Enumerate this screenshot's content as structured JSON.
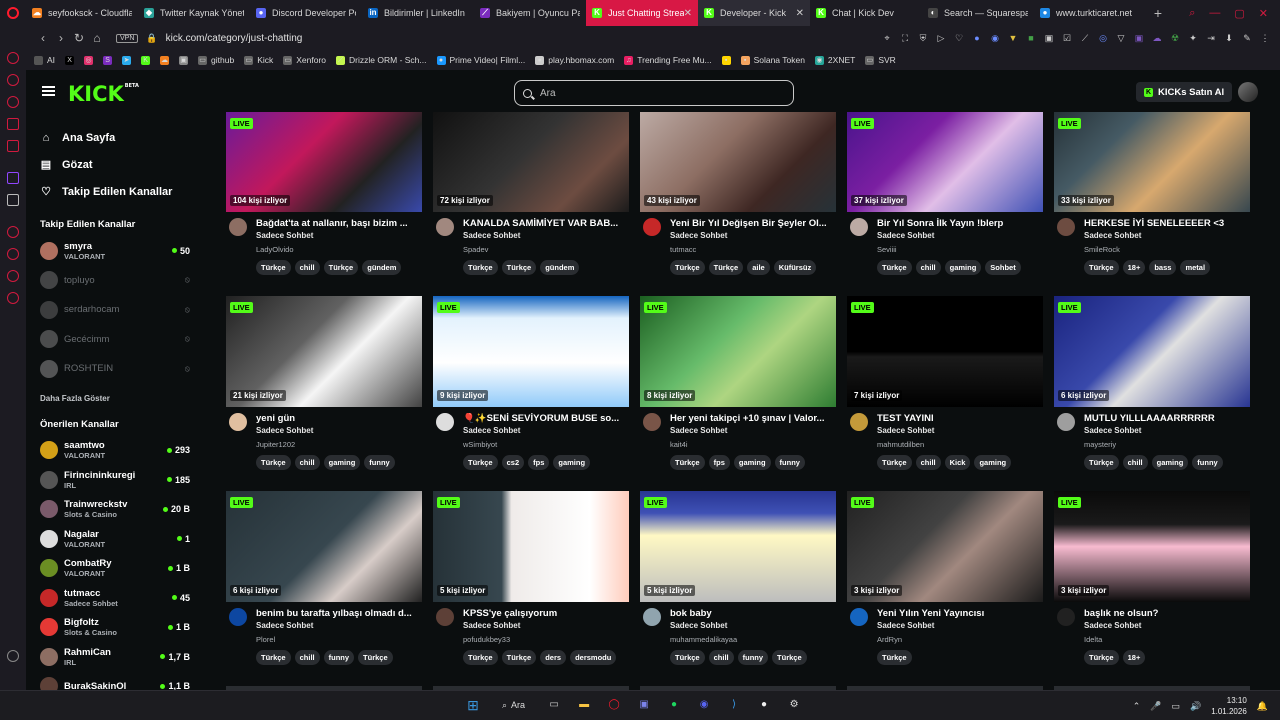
{
  "browser": {
    "tabs": [
      {
        "title": "seyfooksck - Cloudfla",
        "fav_color": "#f38020",
        "fav_glyph": "☁"
      },
      {
        "title": "Twitter Kaynak Yönet",
        "fav_color": "#2aa198",
        "fav_glyph": "◆"
      },
      {
        "title": "Discord Developer Po",
        "fav_color": "#5865f2",
        "fav_glyph": "●"
      },
      {
        "title": "Bildirimler | LinkedIn",
        "fav_color": "#0a66c2",
        "fav_glyph": "in"
      },
      {
        "title": "Bakiyem | Oyuncu Pa",
        "fav_color": "#7b2cbf",
        "fav_glyph": "⟋"
      },
      {
        "title": "Just Chatting Streaming",
        "fav_color": "#53fc18",
        "fav_glyph": "K"
      },
      {
        "title": "Developer - Kick",
        "fav_color": "#53fc18",
        "fav_glyph": "K"
      },
      {
        "title": "Chat | Kick Dev",
        "fav_color": "#53fc18",
        "fav_glyph": "K"
      },
      {
        "title": "Search — Squarespa",
        "fav_color": "#444444",
        "fav_glyph": "◐"
      },
      {
        "title": "www.turkticaret.net",
        "fav_color": "#1e88e5",
        "fav_glyph": "●"
      }
    ],
    "new_tab": "+",
    "url": "kick.com/category/just-chatting",
    "vpn_label": "VPN",
    "bookmarks": [
      {
        "label": "AI",
        "color": "#555555"
      },
      {
        "label": "",
        "color": "#000000",
        "glyph": "X"
      },
      {
        "label": "",
        "color": "#e1306c",
        "glyph": "◎"
      },
      {
        "label": "",
        "color": "#7b2cbf",
        "glyph": "S"
      },
      {
        "label": "",
        "color": "#2aabee",
        "glyph": "➤"
      },
      {
        "label": "",
        "color": "#53fc18",
        "glyph": "K"
      },
      {
        "label": "",
        "color": "#f38020",
        "glyph": "☁"
      },
      {
        "label": "",
        "color": "#888888",
        "glyph": "▣"
      },
      {
        "label": "github",
        "color": "#666666",
        "glyph": "▭"
      },
      {
        "label": "Kick",
        "color": "#666666",
        "glyph": "▭"
      },
      {
        "label": "Xenforo",
        "color": "#666666",
        "glyph": "▭"
      },
      {
        "label": "Drizzle ORM - Sch...",
        "color": "#c5f74f",
        "glyph": "⟋"
      },
      {
        "label": "Prime Video| Filml...",
        "color": "#1a98ff",
        "glyph": "●"
      },
      {
        "label": "play.hbomax.com",
        "color": "#cccccc",
        "glyph": "●"
      },
      {
        "label": "Trending Free Mu...",
        "color": "#e91e63",
        "glyph": "♫"
      },
      {
        "label": "",
        "color": "#ffd600",
        "glyph": "▪"
      },
      {
        "label": "Solana Token",
        "color": "#f4a460",
        "glyph": "▪"
      },
      {
        "label": "2XNET",
        "color": "#26a69a",
        "glyph": "◉"
      },
      {
        "label": "SVR",
        "color": "#666666",
        "glyph": "▭"
      }
    ]
  },
  "kick": {
    "logo": "KICK",
    "logo_badge": "BETA",
    "search_placeholder": "Ara",
    "kicks_button": "KICKs Satın Al",
    "nav": [
      {
        "label": "Ana Sayfa",
        "icon": "home-icon",
        "glyph": "⌂"
      },
      {
        "label": "Gözat",
        "icon": "browse-icon",
        "glyph": "▤"
      },
      {
        "label": "Takip Edilen Kanallar",
        "icon": "heart-icon",
        "glyph": "♡"
      }
    ],
    "followed_title": "Takip Edilen Kanallar",
    "followed": [
      {
        "name": "smyra",
        "category": "VALORANT",
        "count": "50",
        "online": true,
        "color": "#b07060"
      },
      {
        "name": "topluyo",
        "category": "",
        "count": "",
        "online": false,
        "color": "#888888"
      },
      {
        "name": "serdarhocam",
        "category": "",
        "count": "",
        "online": false,
        "color": "#777777"
      },
      {
        "name": "Gecécimm",
        "category": "",
        "count": "",
        "online": false,
        "color": "#999999"
      },
      {
        "name": "ROSHTEIN",
        "category": "",
        "count": "",
        "online": false,
        "color": "#aaaaaa"
      }
    ],
    "show_more": "Daha Fazla Göster",
    "suggested_title": "Önerilen Kanallar",
    "suggested": [
      {
        "name": "saamtwo",
        "category": "VALORANT",
        "count": "293",
        "color": "#d4a017"
      },
      {
        "name": "Firincininkuregi",
        "category": "IRL",
        "count": "185",
        "color": "#555555"
      },
      {
        "name": "Trainwreckstv",
        "category": "Slots & Casino",
        "count": "20 B",
        "color": "#7a5a6a"
      },
      {
        "name": "Nagalar",
        "category": "VALORANT",
        "count": "1",
        "color": "#dddddd"
      },
      {
        "name": "CombatRy",
        "category": "VALORANT",
        "count": "1 B",
        "color": "#6b8e23"
      },
      {
        "name": "tutmacc",
        "category": "Sadece Sohbet",
        "count": "45",
        "color": "#c62828"
      },
      {
        "name": "Bigfoltz",
        "category": "Slots & Casino",
        "count": "1 B",
        "color": "#e53935"
      },
      {
        "name": "RahmiCan",
        "category": "IRL",
        "count": "1,7 B",
        "color": "#8d6e63"
      },
      {
        "name": "BurakSakinOl",
        "category": "",
        "count": "1,1 B",
        "color": "#5d4037"
      }
    ],
    "streams": [
      {
        "live": "LIVE",
        "viewers": "104 kişi izliyor",
        "title": "Bağdat'ta at nallanır, başı bizim ...",
        "category": "Sadece Sohbet",
        "user": "LadyOlvido",
        "tags": [
          "Türkçe",
          "chill",
          "Türkçe",
          "gündem"
        ],
        "bg": "linear-gradient(135deg,#6a1b9a 0%,#c2185b 40%,#222 70%,#3949ab 100%)",
        "av": "#8d6e63"
      },
      {
        "live": "",
        "viewers": "72 kişi izliyor",
        "title": "KANALDA SAMİMİYET VAR BAB...",
        "category": "Sadece Sohbet",
        "user": "Spadev",
        "tags": [
          "Türkçe",
          "Türkçe",
          "gündem"
        ],
        "bg": "linear-gradient(135deg,#111 0%,#333 45%,#6d4c41 75%,#1b1b1b 100%)",
        "av": "#a1887f"
      },
      {
        "live": "",
        "viewers": "43 kişi izliyor",
        "title": "Yeni Bir Yıl Değişen Bir Şeyler Ol...",
        "category": "Sadece Sohbet",
        "user": "tutmacc",
        "tags": [
          "Türkçe",
          "Türkçe",
          "aile",
          "Küfürsüz"
        ],
        "bg": "linear-gradient(135deg,#bcaaa4 0%,#8d6e63 40%,#3e2723 70%,#263238 100%)",
        "av": "#c62828"
      },
      {
        "live": "LIVE",
        "viewers": "37 kişi izliyor",
        "title": "Bir Yıl Sonra İlk Yayın !blerp",
        "category": "Sadece Sohbet",
        "user": "Seviiii",
        "tags": [
          "Türkçe",
          "chill",
          "gaming",
          "Sohbet"
        ],
        "bg": "linear-gradient(135deg,#4a148c 0%,#7b1fa2 35%,#e1bee7 60%,#3f51b5 100%)",
        "av": "#bcaaa4"
      },
      {
        "live": "LIVE",
        "viewers": "33 kişi izliyor",
        "title": "HERKESE İYİ SENELEEEER <3",
        "category": "Sadece Sohbet",
        "user": "SmileRock",
        "tags": [
          "Türkçe",
          "18+",
          "bass",
          "metal"
        ],
        "bg": "linear-gradient(135deg,#263238 0%,#455a64 30%,#d7a86e 60%,#37474f 100%)",
        "av": "#6d4c41"
      },
      {
        "live": "LIVE",
        "viewers": "21 kişi izliyor",
        "title": "yeni gün",
        "category": "Sadece Sohbet",
        "user": "Jupiter1202",
        "tags": [
          "Türkçe",
          "chill",
          "gaming",
          "funny"
        ],
        "bg": "linear-gradient(135deg,#212121 0%,#616161 40%,#f5f5f5 60%,#424242 100%)",
        "av": "#e0bfa0"
      },
      {
        "live": "LIVE",
        "viewers": "9 kişi izliyor",
        "title": "🎈✨SENİ SEVİYORUM BUSE so...",
        "category": "Sadece Sohbet",
        "user": "wSimbiyot",
        "tags": [
          "Türkçe",
          "cs2",
          "fps",
          "gaming"
        ],
        "bg": "linear-gradient(180deg,#1565c0 0%,#e3f2fd 20%,#ffffff 60%,#90caf9 100%)",
        "av": "#dddddd"
      },
      {
        "live": "LIVE",
        "viewers": "8 kişi izliyor",
        "title": "Her yeni takipçi +10 şınav | Valor...",
        "category": "Sadece Sohbet",
        "user": "kait4i",
        "tags": [
          "Türkçe",
          "fps",
          "gaming",
          "funny"
        ],
        "bg": "linear-gradient(135deg,#1b5e20 0%,#66bb6a 40%,#aed581 60%,#2e7d32 100%)",
        "av": "#795548"
      },
      {
        "live": "LIVE",
        "viewers": "7 kişi izliyor",
        "title": "TEST YAYINI",
        "category": "Sadece Sohbet",
        "user": "mahmutdilben",
        "tags": [
          "Türkçe",
          "chill",
          "Kick",
          "gaming"
        ],
        "bg": "linear-gradient(180deg,#000 0%,#000 50%,#1a1a1a 55%,#000 100%)",
        "av": "#c49a3a"
      },
      {
        "live": "LIVE",
        "viewers": "6 kişi izliyor",
        "title": "MUTLU YILLLAAAARRRRRR",
        "category": "Sadece Sohbet",
        "user": "maysteriy",
        "tags": [
          "Türkçe",
          "chill",
          "gaming",
          "funny"
        ],
        "bg": "linear-gradient(135deg,#1a237e 0%,#3949ab 40%,#e0e0e0 55%,#283593 100%)",
        "av": "#9e9e9e"
      },
      {
        "live": "LIVE",
        "viewers": "6 kişi izliyor",
        "title": "benim bu tarafta yılbaşı olmadı d...",
        "category": "Sadece Sohbet",
        "user": "Plorel",
        "tags": [
          "Türkçe",
          "chill",
          "funny",
          "Türkçe"
        ],
        "bg": "linear-gradient(135deg,#263238 0%,#37474f 50%,#d7ccc8 70%,#212121 100%)",
        "av": "#0d47a1"
      },
      {
        "live": "LIVE",
        "viewers": "5 kişi izliyor",
        "title": "KPSS'ye çalışıyorum",
        "category": "Sadece Sohbet",
        "user": "pofudukbey33",
        "tags": [
          "Türkçe",
          "Türkçe",
          "ders",
          "dersmodu"
        ],
        "bg": "linear-gradient(90deg,#263238 0%,#37474f 35%,#efebe9 40%,#ffffff 80%,#ffccbc 100%)",
        "av": "#5d4037"
      },
      {
        "live": "LIVE",
        "viewers": "5 kişi izliyor",
        "title": "bok baby",
        "category": "Sadece Sohbet",
        "user": "muhammedalikayaa",
        "tags": [
          "Türkçe",
          "chill",
          "funny",
          "Türkçe"
        ],
        "bg": "linear-gradient(180deg,#283593 0%,#3f51b5 20%,#fff9c4 40%,#bdbdbd 100%)",
        "av": "#90a4ae"
      },
      {
        "live": "LIVE",
        "viewers": "3 kişi izliyor",
        "title": "Yeni Yılın Yeni Yayıncısı",
        "category": "Sadece Sohbet",
        "user": "ArdRyn",
        "tags": [
          "Türkçe"
        ],
        "bg": "linear-gradient(135deg,#212121 0%,#424242 40%,#a1887f 60%,#1b1b1b 100%)",
        "av": "#1565c0"
      },
      {
        "live": "LIVE",
        "viewers": "3 kişi izliyor",
        "title": "başlık ne olsun?",
        "category": "Sadece Sohbet",
        "user": "Idelta",
        "tags": [
          "Türkçe",
          "18+"
        ],
        "bg": "linear-gradient(180deg,#0a0a0a 0%,#1a1a1a 30%,#f8bbd0 50%,#0a0a0a 100%)",
        "av": "#212121"
      }
    ]
  },
  "taskbar": {
    "search_label": "Ara",
    "time": "13:10",
    "date": "1.01.2026"
  }
}
